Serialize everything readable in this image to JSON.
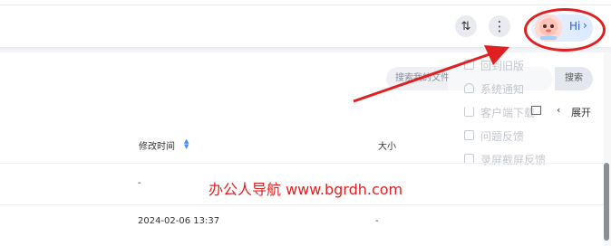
{
  "header": {
    "sort_icon_glyph": "⇅",
    "more_icon_glyph": "⋮",
    "greeting": "Hi",
    "greeting_chevron": "›"
  },
  "search": {
    "placeholder": "搜索我的文件",
    "button_label": "搜索"
  },
  "menu": {
    "items": [
      {
        "label": "回到旧版",
        "icon": "back-icon"
      },
      {
        "label": "系统通知",
        "icon": "bell-icon"
      },
      {
        "label": "客户端下载",
        "icon": "download-icon"
      },
      {
        "label": "问题反馈",
        "icon": "feedback-icon"
      },
      {
        "label": "录屏截屏反馈",
        "icon": "record-icon"
      }
    ]
  },
  "toolbar": {
    "expand_chevron": "‹",
    "expand_label": "展开"
  },
  "table": {
    "columns": [
      "修改时间",
      "大小"
    ],
    "rows": [
      {
        "modified": "-",
        "size": ""
      },
      {
        "modified": "2024-02-06 13:37",
        "size": "-"
      }
    ]
  },
  "watermark": "办公人导航 www.bgrdh.com",
  "colors": {
    "annotation_red": "#e02020",
    "accent_blue": "#2c5ad8"
  }
}
